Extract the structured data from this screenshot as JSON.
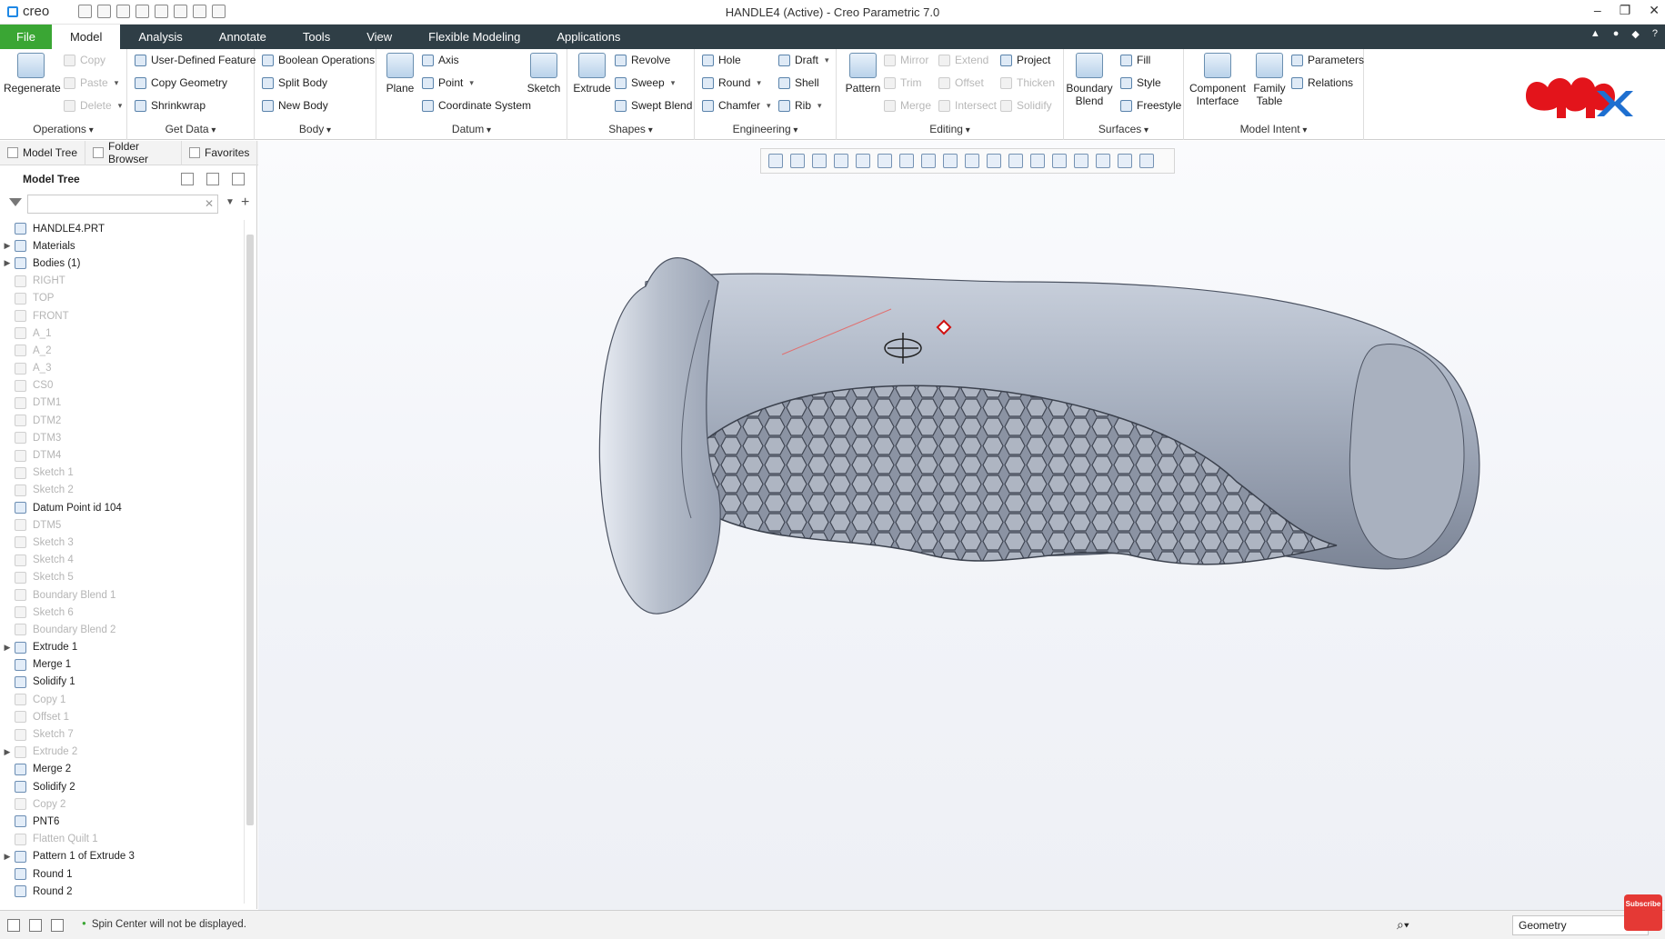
{
  "app": {
    "logo": "creo",
    "title": "HANDLE4 (Active) - Creo Parametric 7.0"
  },
  "menu": [
    "File",
    "Model",
    "Analysis",
    "Annotate",
    "Tools",
    "View",
    "Flexible Modeling",
    "Applications"
  ],
  "ribbon": {
    "operations": {
      "label": "Operations",
      "regenerate": "Regenerate",
      "copy": "Copy",
      "paste": "Paste",
      "delete": "Delete"
    },
    "get_data": {
      "label": "Get Data",
      "udf": "User-Defined Feature",
      "copy_geometry": "Copy Geometry",
      "shrinkwrap": "Shrinkwrap"
    },
    "body": {
      "label": "Body",
      "boolean": "Boolean Operations",
      "split": "Split Body",
      "new": "New Body"
    },
    "datum": {
      "label": "Datum",
      "plane": "Plane",
      "axis": "Axis",
      "point": "Point",
      "csys": "Coordinate System",
      "sketch": "Sketch"
    },
    "shapes": {
      "label": "Shapes",
      "extrude": "Extrude",
      "revolve": "Revolve",
      "sweep": "Sweep",
      "swept_blend": "Swept Blend"
    },
    "engineering": {
      "label": "Engineering",
      "hole": "Hole",
      "round": "Round",
      "chamfer": "Chamfer",
      "draft": "Draft",
      "shell": "Shell",
      "rib": "Rib"
    },
    "editing": {
      "label": "Editing",
      "pattern": "Pattern",
      "mirror": "Mirror",
      "trim": "Trim",
      "merge": "Merge",
      "extend": "Extend",
      "offset": "Offset",
      "intersect": "Intersect",
      "project": "Project",
      "thicken": "Thicken",
      "solidify": "Solidify"
    },
    "surfaces": {
      "label": "Surfaces",
      "boundary_blend_1": "Boundary",
      "boundary_blend_2": "Blend",
      "fill": "Fill",
      "style": "Style",
      "freestyle": "Freestyle"
    },
    "model_intent": {
      "label": "Model Intent",
      "comp_1": "Component",
      "comp_2": "Interface",
      "family_1": "Family",
      "family_2": "Table",
      "parameters": "Parameters",
      "relations": "Relations"
    }
  },
  "panel_tabs": [
    "Model Tree",
    "Folder Browser",
    "Favorites"
  ],
  "model_tree": {
    "title": "Model Tree",
    "filter_value": "",
    "items": [
      {
        "label": "HANDLE4.PRT",
        "dim": false,
        "exp": ""
      },
      {
        "label": "Materials",
        "dim": false,
        "exp": "▶"
      },
      {
        "label": "Bodies (1)",
        "dim": false,
        "exp": "▶"
      },
      {
        "label": "RIGHT",
        "dim": true,
        "exp": ""
      },
      {
        "label": "TOP",
        "dim": true,
        "exp": ""
      },
      {
        "label": "FRONT",
        "dim": true,
        "exp": ""
      },
      {
        "label": "A_1",
        "dim": true,
        "exp": ""
      },
      {
        "label": "A_2",
        "dim": true,
        "exp": ""
      },
      {
        "label": "A_3",
        "dim": true,
        "exp": ""
      },
      {
        "label": "CS0",
        "dim": true,
        "exp": ""
      },
      {
        "label": "DTM1",
        "dim": true,
        "exp": ""
      },
      {
        "label": "DTM2",
        "dim": true,
        "exp": ""
      },
      {
        "label": "DTM3",
        "dim": true,
        "exp": ""
      },
      {
        "label": "DTM4",
        "dim": true,
        "exp": ""
      },
      {
        "label": "Sketch 1",
        "dim": true,
        "exp": ""
      },
      {
        "label": "Sketch 2",
        "dim": true,
        "exp": ""
      },
      {
        "label": "Datum Point id 104",
        "dim": false,
        "exp": ""
      },
      {
        "label": "DTM5",
        "dim": true,
        "exp": ""
      },
      {
        "label": "Sketch 3",
        "dim": true,
        "exp": ""
      },
      {
        "label": "Sketch 4",
        "dim": true,
        "exp": ""
      },
      {
        "label": "Sketch 5",
        "dim": true,
        "exp": ""
      },
      {
        "label": "Boundary Blend 1",
        "dim": true,
        "exp": ""
      },
      {
        "label": "Sketch 6",
        "dim": true,
        "exp": ""
      },
      {
        "label": "Boundary Blend 2",
        "dim": true,
        "exp": ""
      },
      {
        "label": "Extrude 1",
        "dim": false,
        "exp": "▶"
      },
      {
        "label": "Merge 1",
        "dim": false,
        "exp": ""
      },
      {
        "label": "Solidify 1",
        "dim": false,
        "exp": ""
      },
      {
        "label": "Copy 1",
        "dim": true,
        "exp": ""
      },
      {
        "label": "Offset 1",
        "dim": true,
        "exp": ""
      },
      {
        "label": "Sketch 7",
        "dim": true,
        "exp": ""
      },
      {
        "label": "Extrude 2",
        "dim": true,
        "exp": "▶"
      },
      {
        "label": "Merge 2",
        "dim": false,
        "exp": ""
      },
      {
        "label": "Solidify 2",
        "dim": false,
        "exp": ""
      },
      {
        "label": "Copy 2",
        "dim": true,
        "exp": ""
      },
      {
        "label": "PNT6",
        "dim": false,
        "exp": ""
      },
      {
        "label": "Flatten Quilt 1",
        "dim": true,
        "exp": ""
      },
      {
        "label": "Pattern 1 of Extrude 3",
        "dim": false,
        "exp": "▶"
      },
      {
        "label": "Round 1",
        "dim": false,
        "exp": ""
      },
      {
        "label": "Round 2",
        "dim": false,
        "exp": ""
      }
    ]
  },
  "status": {
    "message": "Spin Center will not be displayed.",
    "filter": "Geometry"
  },
  "subscribe_label": "Subscribe",
  "colors": {
    "file_green": "#3aa634",
    "menubar": "#2f3e46",
    "brand_red": "#e3141b",
    "brand_blue": "#1e6fd0"
  }
}
